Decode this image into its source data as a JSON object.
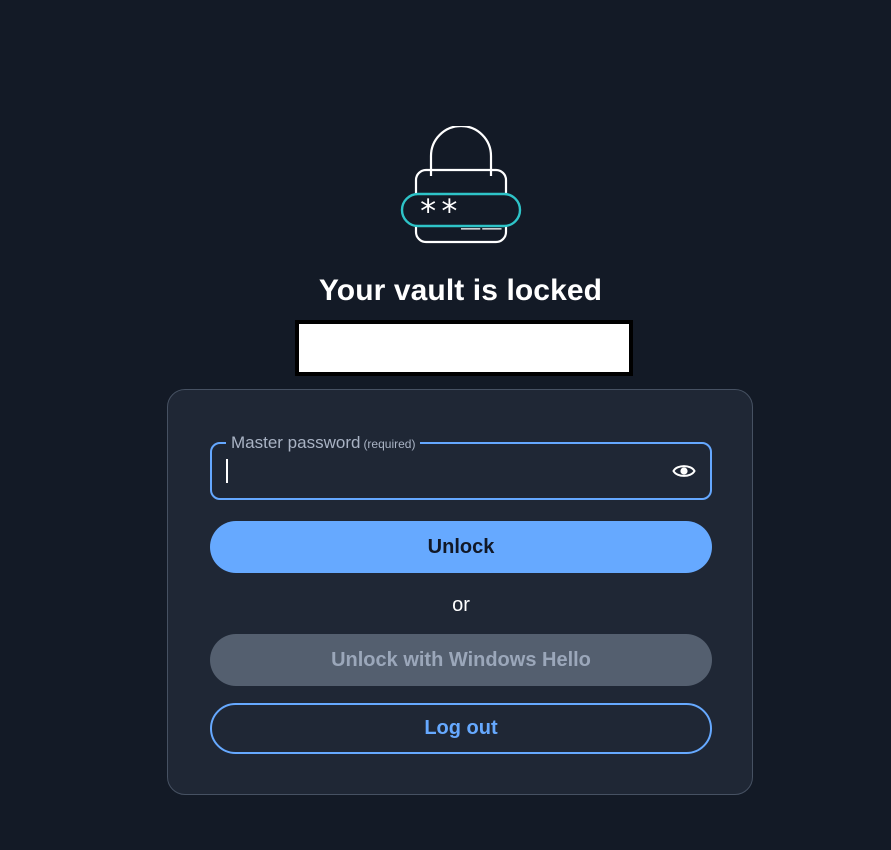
{
  "lock": {
    "icon": "lock-password-icon",
    "mask_text": "**__",
    "accent_color": "#2ec4c8"
  },
  "title": "Your vault is locked",
  "form": {
    "password_label": "Master password",
    "password_required": "(required)",
    "password_value": "",
    "toggle_icon": "eye-icon",
    "unlock_label": "Unlock",
    "or_text": "or",
    "windows_hello_label": "Unlock with Windows Hello",
    "logout_label": "Log out"
  },
  "colors": {
    "background": "#131a26",
    "card": "#1f2735",
    "primary": "#66a9ff",
    "disabled": "#545f6f"
  }
}
